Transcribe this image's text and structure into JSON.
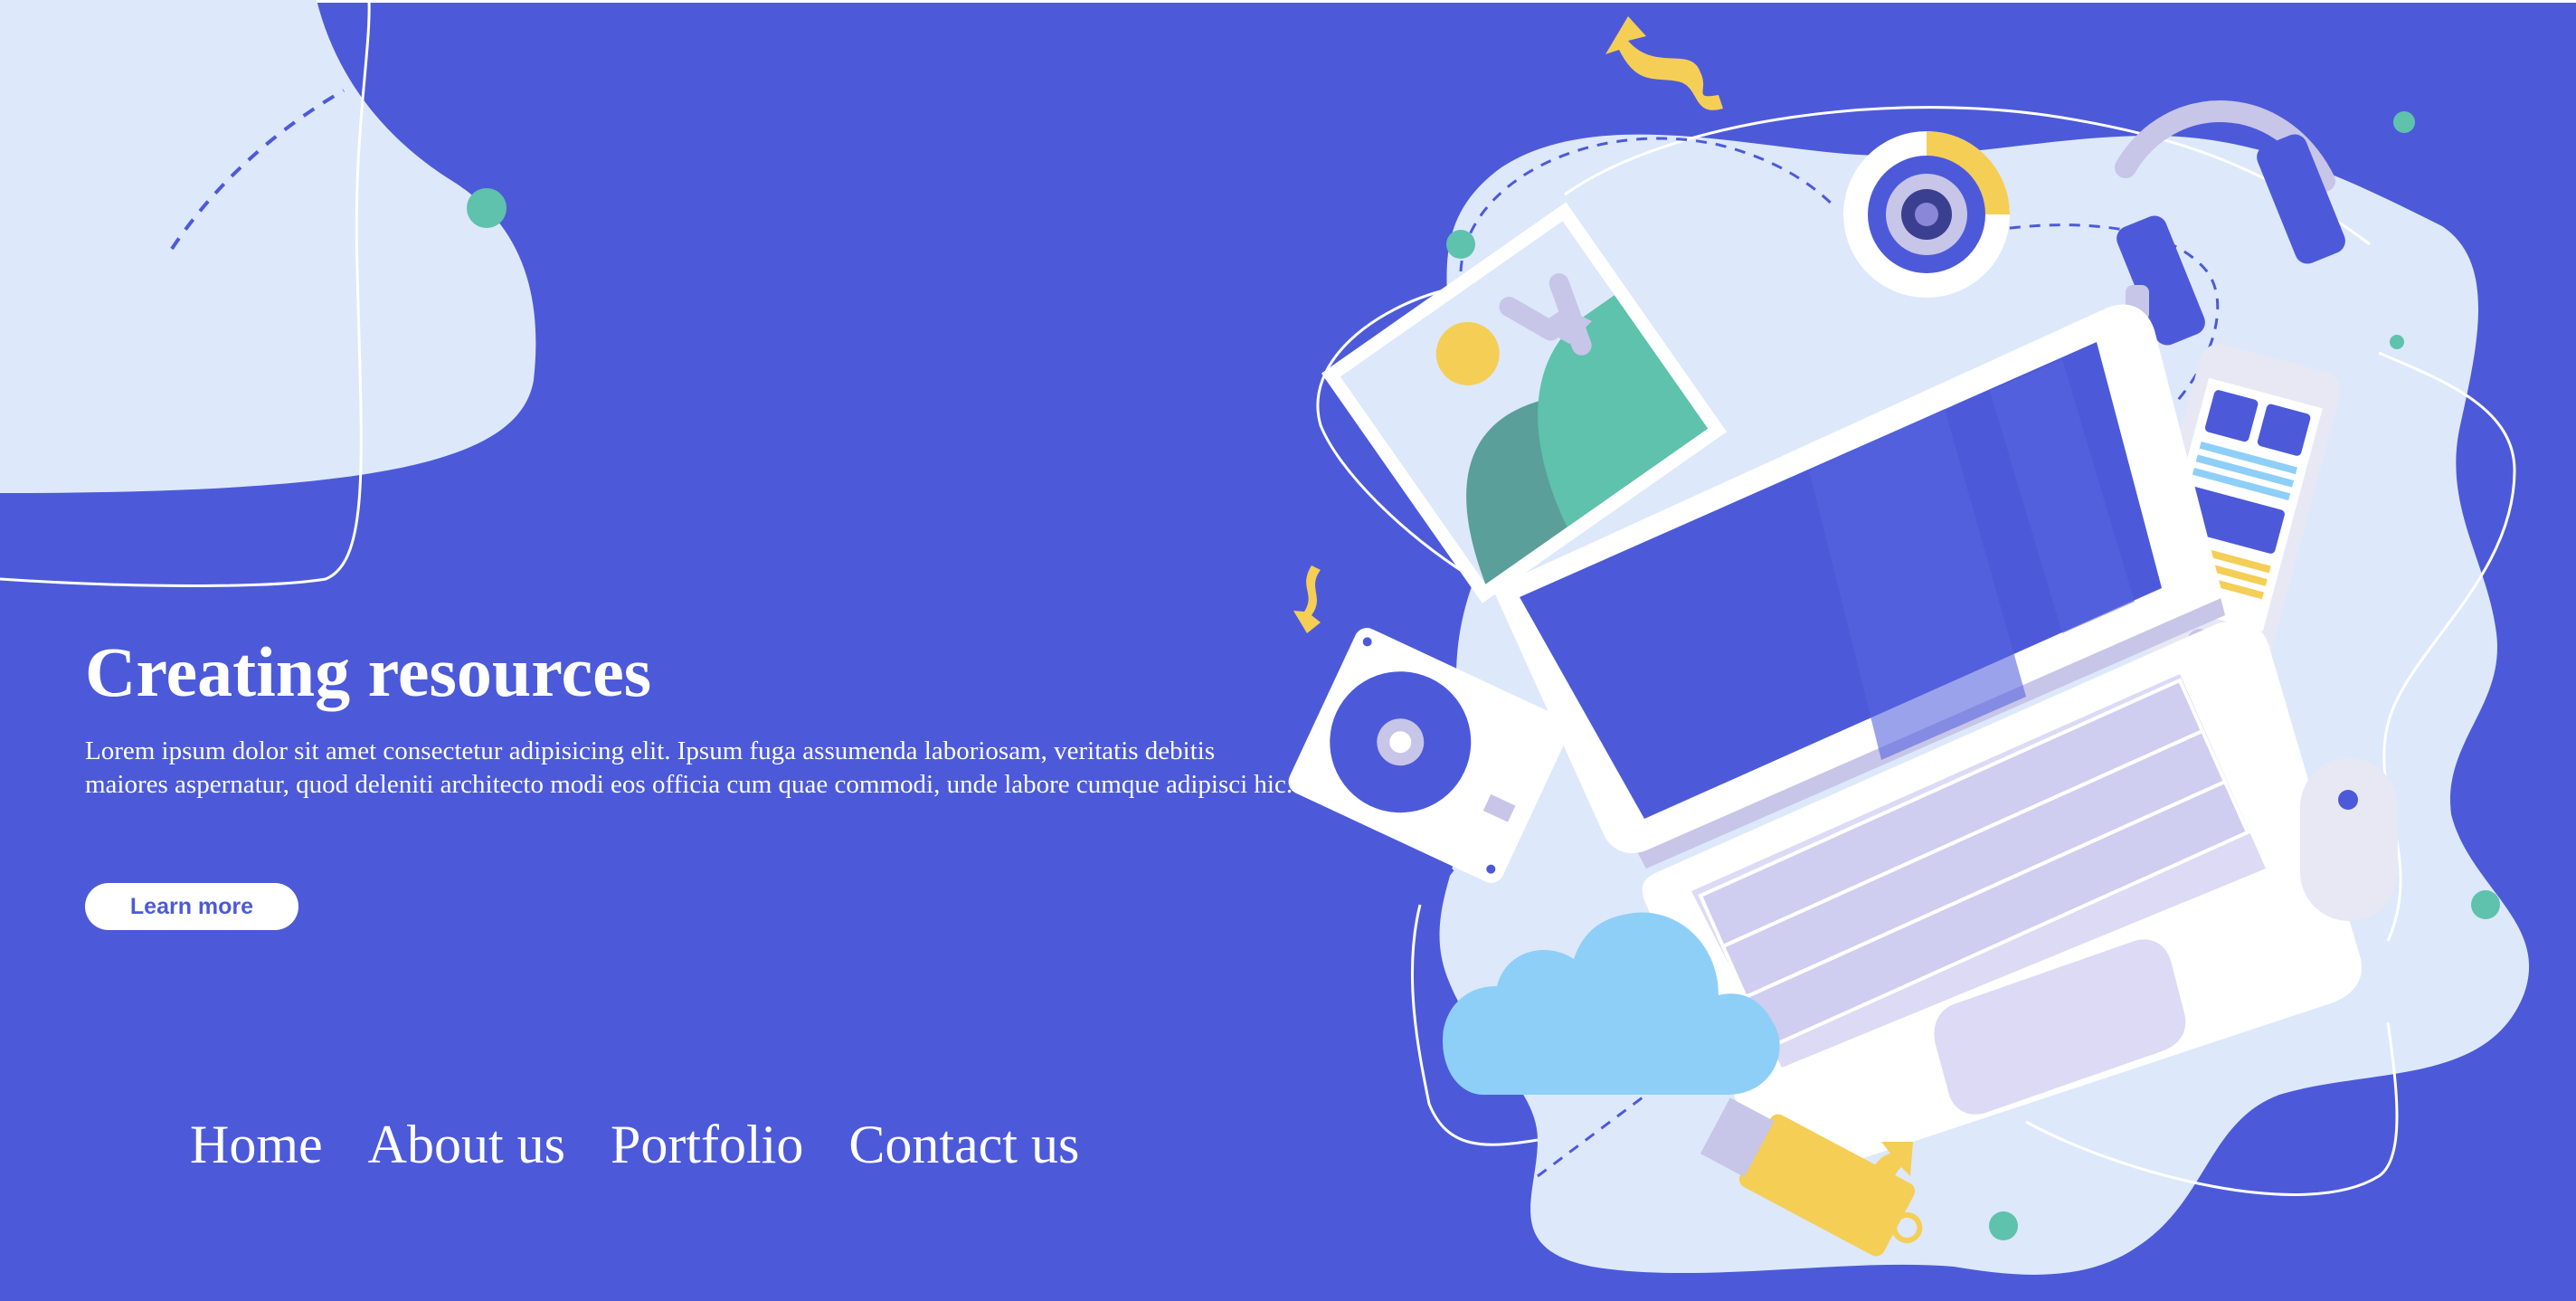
{
  "colors": {
    "background": "#4c5ad9",
    "blob": "#dde8fb",
    "accent_yellow": "#f5ce56",
    "accent_teal": "#5ec2ad",
    "cloud": "#8ecff8",
    "keyboard_keys": "#cfcdf0"
  },
  "hero": {
    "title": "Creating resources",
    "body": "Lorem ipsum dolor sit amet consectetur adipisicing elit. Ipsum fuga assumenda laboriosam, veritatis debitis maiores aspernatur, quod deleniti architecto modi eos officia cum quae commodi, unde labore cumque adipisci hic.",
    "button_label": "Learn more"
  },
  "nav": {
    "items": [
      {
        "label": "Home"
      },
      {
        "label": "About us"
      },
      {
        "label": "Portfolio"
      },
      {
        "label": "Contact us"
      }
    ]
  },
  "illustration": {
    "icons": [
      "laptop-icon",
      "photo-icon",
      "webcam-icon",
      "headphones-icon",
      "smartphone-icon",
      "disc-drive-icon",
      "mouse-icon",
      "cloud-icon",
      "usb-drive-icon",
      "arrow-icon"
    ]
  }
}
